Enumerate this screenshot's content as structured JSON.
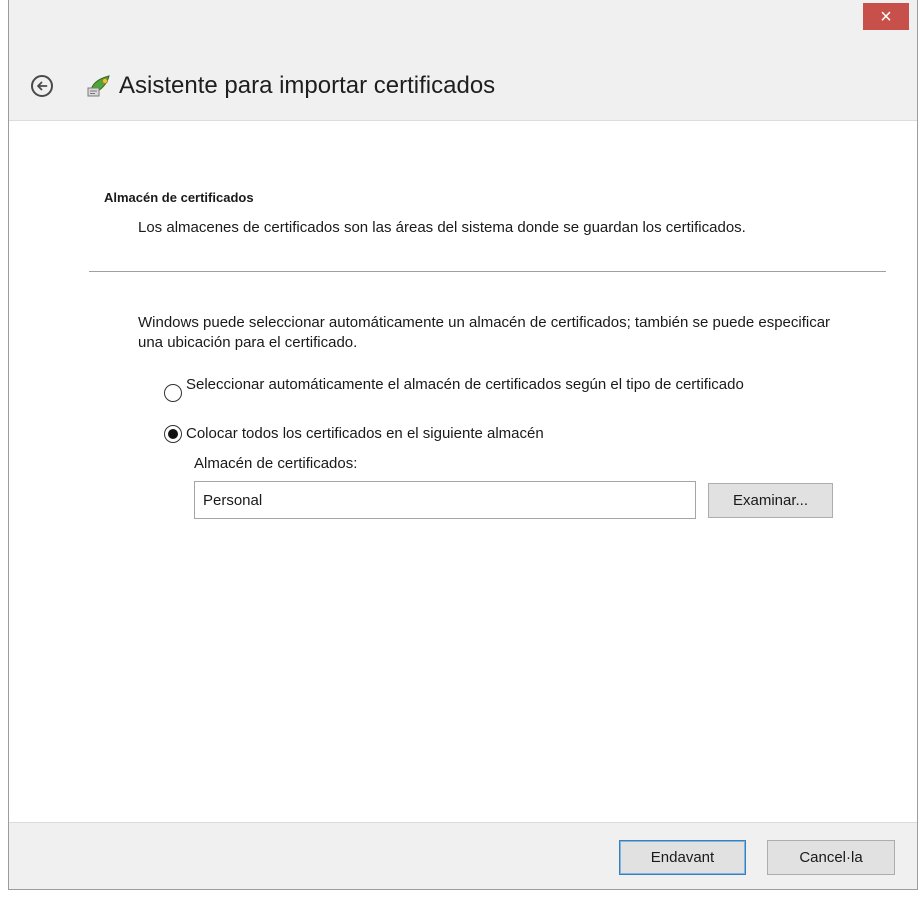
{
  "window": {
    "close_symbol": "×",
    "title": "Asistente para importar certificados",
    "back_icon": "back-arrow-icon",
    "wizard_icon": "certificate-icon",
    "close_color": "#c7504a"
  },
  "section": {
    "heading": "Almacén de certificados",
    "description": "Los almacenes de certificados son las áreas del sistema donde se guardan los certificados."
  },
  "content": {
    "intro": "Windows puede seleccionar automáticamente un almacén de certificados; también se puede especificar una ubicación para el certificado.",
    "options": [
      {
        "label": "Seleccionar automáticamente el almacén de certificados según el tipo de certificado",
        "selected": false
      },
      {
        "label": "Colocar todos los certificados en el siguiente almacén",
        "selected": true
      }
    ],
    "store_label": "Almacén de certificados:",
    "store_value": "Personal",
    "browse_label": "Examinar..."
  },
  "footer": {
    "next_label": "Endavant",
    "cancel_label": "Cancel·la"
  }
}
